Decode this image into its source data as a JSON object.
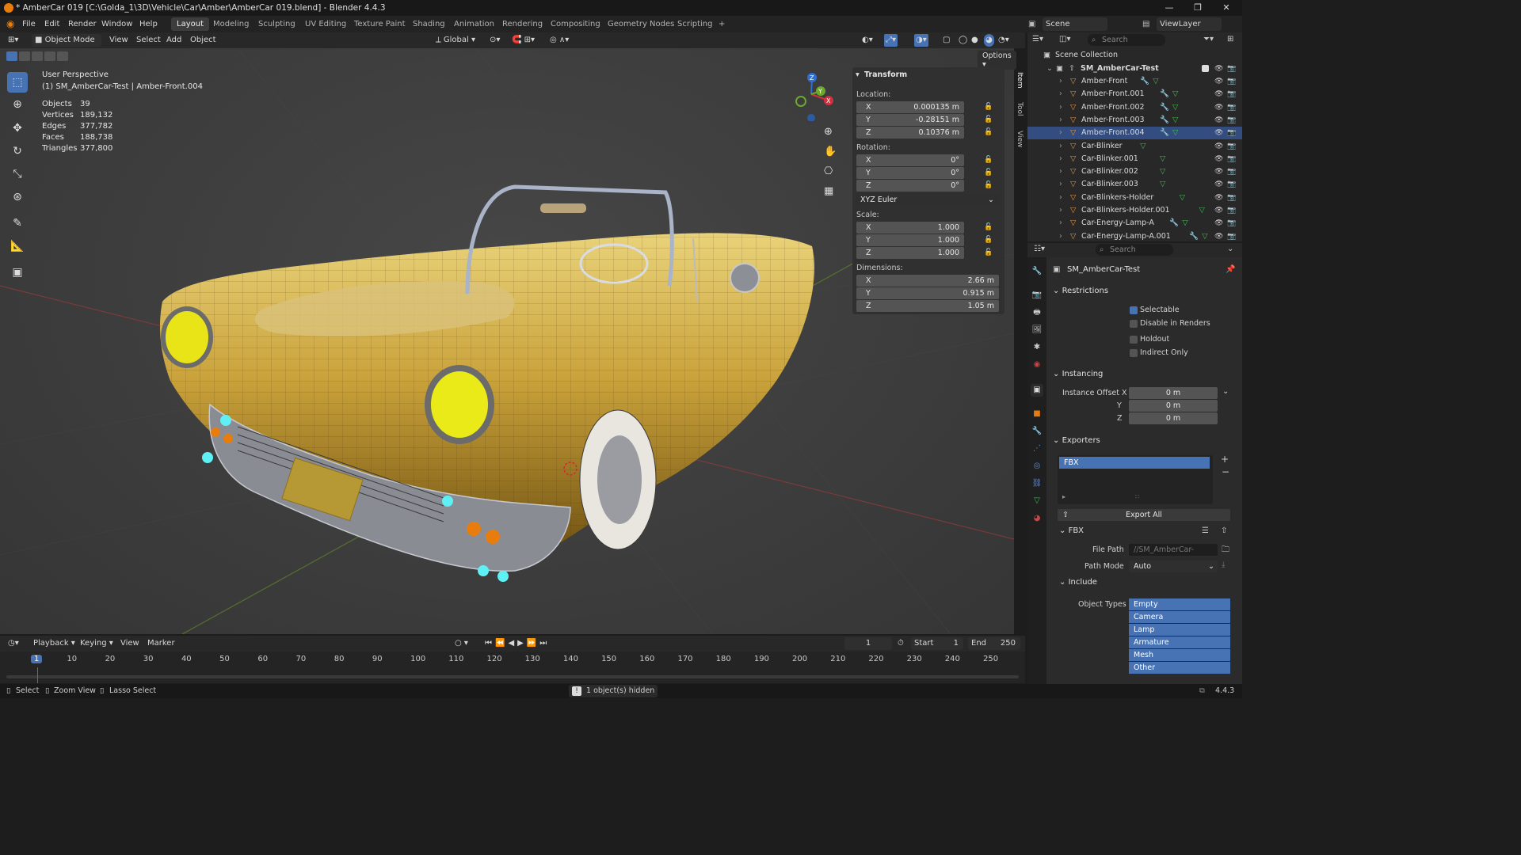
{
  "window": {
    "title": "* AmberCar 019 [C:\\Golda_1\\3D\\Vehicle\\Car\\Amber\\AmberCar 019.blend] - Blender 4.4.3",
    "minimize": "—",
    "maximize": "❐",
    "close": "✕"
  },
  "menu": {
    "file": "File",
    "edit": "Edit",
    "render": "Render",
    "window": "Window",
    "help": "Help"
  },
  "workspaces": [
    "Layout",
    "Modeling",
    "Sculpting",
    "UV Editing",
    "Texture Paint",
    "Shading",
    "Animation",
    "Rendering",
    "Compositing",
    "Geometry Nodes",
    "Scripting"
  ],
  "add_workspace": "+",
  "scene": {
    "name": "Scene",
    "view_layer": "ViewLayer"
  },
  "viewport_header": {
    "mode": "Object Mode",
    "view": "View",
    "select": "Select",
    "add": "Add",
    "object": "Object",
    "orientation": "Global",
    "options": "Options"
  },
  "viewport_info": {
    "perspective": "User Perspective",
    "active": "(1) SM_AmberCar-Test | Amber-Front.004",
    "stats": [
      {
        "label": "Objects",
        "value": "39"
      },
      {
        "label": "Vertices",
        "value": "189,132"
      },
      {
        "label": "Edges",
        "value": "377,782"
      },
      {
        "label": "Faces",
        "value": "188,738"
      },
      {
        "label": "Triangles",
        "value": "377,800"
      }
    ]
  },
  "gizmo": {
    "z": "Z",
    "y": "Y",
    "x": "X"
  },
  "transform": {
    "title": "Transform",
    "location_label": "Location:",
    "location": [
      {
        "axis": "X",
        "value": "0.000135 m"
      },
      {
        "axis": "Y",
        "value": "-0.28151 m"
      },
      {
        "axis": "Z",
        "value": "0.10376 m"
      }
    ],
    "rotation_label": "Rotation:",
    "rotation": [
      {
        "axis": "X",
        "value": "0°"
      },
      {
        "axis": "Y",
        "value": "0°"
      },
      {
        "axis": "Z",
        "value": "0°"
      }
    ],
    "rotation_mode": "XYZ Euler",
    "scale_label": "Scale:",
    "scale": [
      {
        "axis": "X",
        "value": "1.000"
      },
      {
        "axis": "Y",
        "value": "1.000"
      },
      {
        "axis": "Z",
        "value": "1.000"
      }
    ],
    "dimensions_label": "Dimensions:",
    "dimensions": [
      {
        "axis": "X",
        "value": "2.66 m"
      },
      {
        "axis": "Y",
        "value": "0.915 m"
      },
      {
        "axis": "Z",
        "value": "1.05 m"
      }
    ]
  },
  "sidebar_tabs": [
    "Item",
    "Tool",
    "View"
  ],
  "outliner": {
    "search_placeholder": "Search",
    "scene_collection": "Scene Collection",
    "collection": "SM_AmberCar-Test",
    "items": [
      "Amber-Front",
      "Amber-Front.001",
      "Amber-Front.002",
      "Amber-Front.003",
      "Amber-Front.004",
      "Car-Blinker",
      "Car-Blinker.001",
      "Car-Blinker.002",
      "Car-Blinker.003",
      "Car-Blinkers-Holder",
      "Car-Blinkers-Holder.001",
      "Car-Energy-Lamp-A",
      "Car-Energy-Lamp-A.001"
    ]
  },
  "properties": {
    "search_placeholder": "Search",
    "collection_name": "SM_AmberCar-Test",
    "restrictions": "Restrictions",
    "selectable": "Selectable",
    "disable_in_renders": "Disable in Renders",
    "holdout": "Holdout",
    "indirect_only": "Indirect Only",
    "instancing": "Instancing",
    "instance_offset_x": "Instance Offset X",
    "instance_y": "Y",
    "instance_z": "Z",
    "offset_values": [
      "0 m",
      "0 m",
      "0 m"
    ],
    "exporters": "Exporters",
    "exporter_item": "FBX",
    "export_all": "Export All",
    "fbx": "FBX",
    "file_path_label": "File Path",
    "file_path": "//SM_AmberCar-Test.fb",
    "path_mode_label": "Path Mode",
    "path_mode": "Auto",
    "include": "Include",
    "object_types_label": "Object Types",
    "object_types": [
      "Empty",
      "Camera",
      "Lamp",
      "Armature",
      "Mesh",
      "Other"
    ]
  },
  "timeline": {
    "playback": "Playback",
    "keying": "Keying",
    "view": "View",
    "marker": "Marker",
    "current_frame": "1",
    "start_label": "Start",
    "start": "1",
    "end_label": "End",
    "end": "250",
    "ticks": [
      "1",
      "10",
      "20",
      "30",
      "40",
      "50",
      "60",
      "70",
      "80",
      "90",
      "100",
      "110",
      "120",
      "130",
      "140",
      "150",
      "160",
      "170",
      "180",
      "190",
      "200",
      "210",
      "220",
      "230",
      "240",
      "250"
    ]
  },
  "statusbar": {
    "select": "Select",
    "zoom": "Zoom View",
    "lasso": "Lasso Select",
    "message": "1 object(s) hidden",
    "version": "4.4.3"
  }
}
